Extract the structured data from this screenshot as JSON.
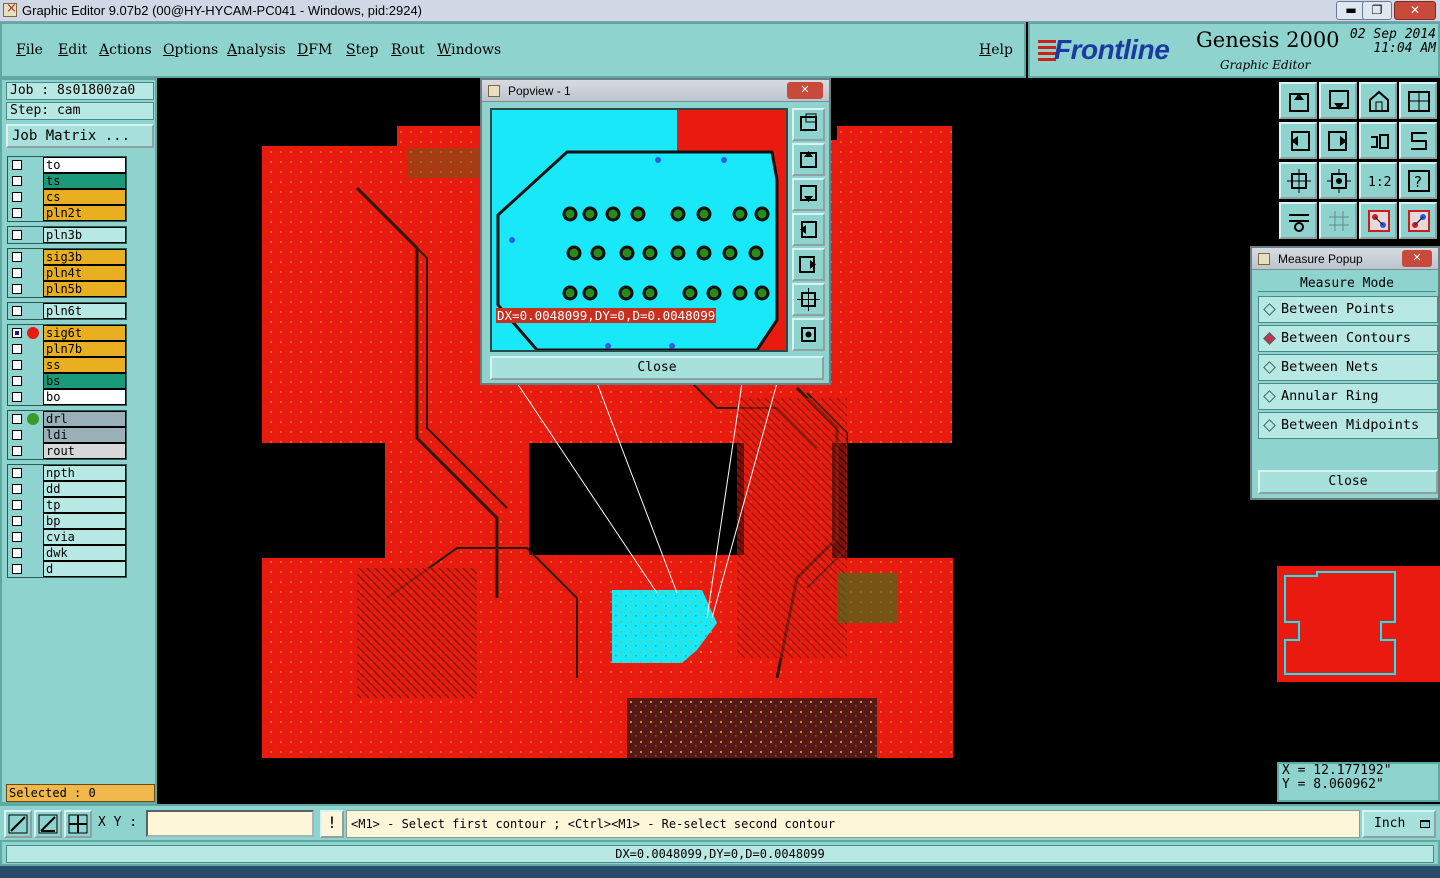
{
  "window": {
    "title": "Graphic Editor 9.07b2 (00@HY-HYCAM-PC041 - Windows, pid:2924)",
    "minimize": "▬",
    "maximize": "❐",
    "close": "✕"
  },
  "menu": [
    "File",
    "Edit",
    "Actions",
    "Options",
    "Analysis",
    "DFM",
    "Step",
    "Rout",
    "Windows"
  ],
  "help": "Help",
  "brand": {
    "logo": "Frontline",
    "product": "Genesis 2000",
    "subtitle": "Graphic Editor",
    "date": "02  Sep 2014",
    "time": "11:04 AM"
  },
  "job": {
    "job_label": "Job : 8s01800za0",
    "step_label": "Step: cam",
    "matrix_button": "Job Matrix ..."
  },
  "layer_groups": [
    [
      {
        "name": "to",
        "color": "#ffffff",
        "flag": "↙"
      },
      {
        "name": "ts",
        "color": "#1a9a7a",
        "flag": ""
      },
      {
        "name": "cs",
        "color": "#e8b020",
        "flag": "↙"
      },
      {
        "name": "pln2t",
        "color": "#e8b020",
        "flag": ""
      }
    ],
    [
      {
        "name": "pln3b",
        "color": "#b8e8e4",
        "flag": ""
      }
    ],
    [
      {
        "name": "sig3b",
        "color": "#e8b020",
        "flag": ""
      },
      {
        "name": "pln4t",
        "color": "#e8b020",
        "flag": ""
      },
      {
        "name": "pln5b",
        "color": "#e8b020",
        "flag": ""
      }
    ],
    [
      {
        "name": "pln6t",
        "color": "#b8e8e4",
        "flag": ""
      }
    ],
    [
      {
        "name": "sig6t",
        "color": "#e8b020",
        "flag": "⊞",
        "mark": "#ea1a10",
        "active": true
      },
      {
        "name": "pln7b",
        "color": "#e8b020",
        "flag": ""
      },
      {
        "name": "ss",
        "color": "#e8b020",
        "flag": "↙"
      },
      {
        "name": "bs",
        "color": "#1a9a7a",
        "flag": ""
      },
      {
        "name": "bo",
        "color": "#ffffff",
        "flag": "↙"
      }
    ],
    [
      {
        "name": "drl",
        "color": "#9ab0b8",
        "flag": "",
        "mark": "#3a9a2a"
      },
      {
        "name": "ldi",
        "color": "#9ab0b8",
        "flag": ""
      },
      {
        "name": "rout",
        "color": "#d8d8d8",
        "flag": ""
      }
    ],
    [
      {
        "name": "npth",
        "color": "#b8e8e4",
        "flag": ""
      },
      {
        "name": "dd",
        "color": "#b8e8e4",
        "flag": ""
      },
      {
        "name": "tp",
        "color": "#b8e8e4",
        "flag": ""
      },
      {
        "name": "bp",
        "color": "#b8e8e4",
        "flag": ""
      },
      {
        "name": "cvia",
        "color": "#b8e8e4",
        "flag": ""
      },
      {
        "name": "dwk",
        "color": "#b8e8e4",
        "flag": ""
      },
      {
        "name": "d",
        "color": "#b8e8e4",
        "flag": ""
      }
    ]
  ],
  "selected": "Selected : 0",
  "popview": {
    "title": "Popview - 1",
    "measurement": "DX=0.0048099,DY=0,D=0.0048099",
    "close": "Close"
  },
  "measure_popup": {
    "title": "Measure Popup",
    "heading": "Measure Mode",
    "options": [
      "Between Points",
      "Between Contours",
      "Between Nets",
      "Annular Ring",
      "Between Midpoints"
    ],
    "selected_index": 1,
    "close": "Close"
  },
  "coords": {
    "x": "X  = 12.177192\"",
    "y": "Y  = 8.060962\""
  },
  "bottom": {
    "xy_label": "X Y :",
    "xy_value": "",
    "warn": "!",
    "prompt": "<M1> - Select first contour ; <Ctrl><M1> - Re-select second contour",
    "unit": "Inch"
  },
  "status": "DX=0.0048099,DY=0,D=0.0048099",
  "colors": {
    "panel": "#8fd3cf",
    "copper": "#ea1a10",
    "highlight": "#18e8f8",
    "trace": "#2a8a1a"
  }
}
